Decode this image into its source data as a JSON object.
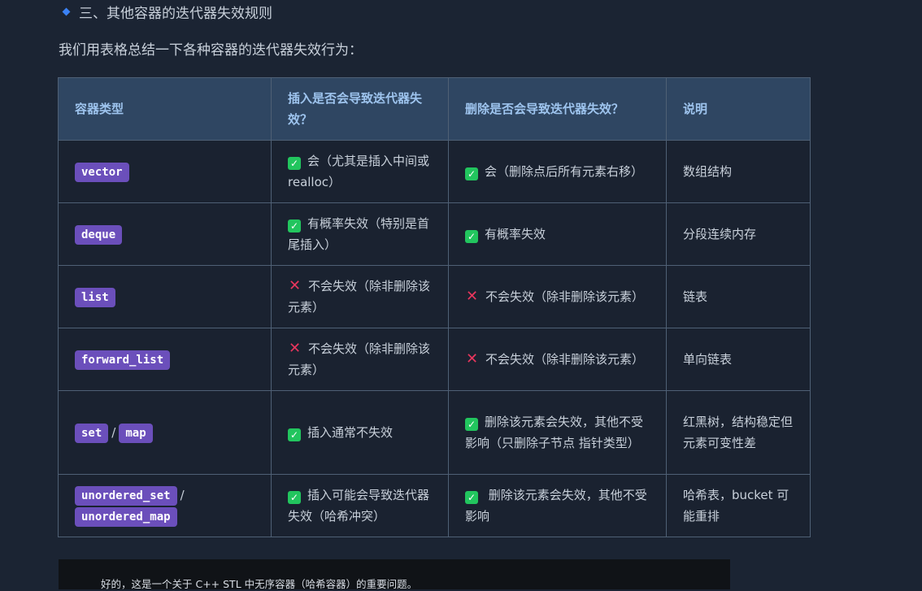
{
  "heading": "三、其他容器的迭代器失效规则",
  "intro": "我们用表格总结一下各种容器的迭代器失效行为：",
  "table": {
    "headers": [
      "容器类型",
      "插入是否会导致迭代器失效？",
      "删除是否会导致迭代器失效？",
      "说明"
    ],
    "rows": [
      {
        "containers": [
          "vector"
        ],
        "insert_icon": "check",
        "insert": "会（尤其是插入中间或 realloc）",
        "delete_icon": "check",
        "delete": "会（删除点后所有元素右移）",
        "note": "数组结构"
      },
      {
        "containers": [
          "deque"
        ],
        "insert_icon": "check",
        "insert": "有概率失效（特别是首尾插入）",
        "delete_icon": "check",
        "delete": "有概率失效",
        "note": "分段连续内存"
      },
      {
        "containers": [
          "list"
        ],
        "insert_icon": "cross",
        "insert": "不会失效（除非删除该元素）",
        "delete_icon": "cross",
        "delete": "不会失效（除非删除该元素）",
        "note": "链表"
      },
      {
        "containers": [
          "forward_list"
        ],
        "insert_icon": "cross",
        "insert": "不会失效（除非删除该元素）",
        "delete_icon": "cross",
        "delete": "不会失效（除非删除该元素）",
        "note": "单向链表"
      },
      {
        "containers": [
          "set",
          "map"
        ],
        "separator": "/",
        "insert_icon": "check",
        "insert": "插入通常不失效",
        "delete_icon": "check",
        "delete": "删除该元素会失效，其他不受影响（只删除子节点 指针类型）",
        "note": "红黑树，结构稳定但元素可变性差"
      },
      {
        "containers": [
          "unordered_set",
          "unordered_map"
        ],
        "separator": "/",
        "insert_icon": "check",
        "insert": "插入可能会导致迭代器失效（哈希冲突）",
        "delete_icon": "check",
        "delete": " 删除该元素会失效，其他不受影响",
        "note": "哈希表，bucket 可能重排"
      }
    ]
  },
  "preview": "好的，这是一个关于 C++ STL 中无序容器（哈希容器）的重要问题。",
  "colors": {
    "code_bg": "#6b4fbb",
    "check": "#22c55e",
    "cross": "#e8365d",
    "header_bg": "#2f4662"
  }
}
